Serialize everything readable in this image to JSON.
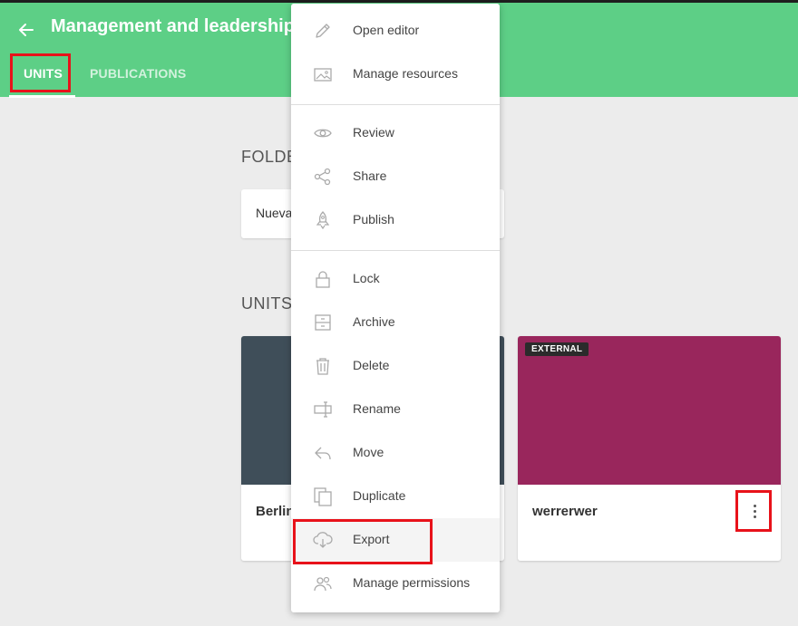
{
  "header": {
    "title": "Management and leadership",
    "tabs": [
      {
        "label": "UNITS",
        "active": true
      },
      {
        "label": "PUBLICATIONS",
        "active": false
      }
    ],
    "color": "#5dcf86"
  },
  "main": {
    "folders_heading": "FOLDE",
    "folder_name": "Nueva",
    "units_heading": "UNITS",
    "units": [
      {
        "name": "Berlin",
        "thumb_color": "#3f4e59",
        "badge": ""
      },
      {
        "name": "werrerwer",
        "thumb_color": "#99265c",
        "badge": "EXTERNAL"
      }
    ]
  },
  "context_menu": {
    "groups": [
      [
        {
          "label": "Open editor",
          "icon": "pencil-icon"
        },
        {
          "label": "Manage resources",
          "icon": "image-icon"
        }
      ],
      [
        {
          "label": "Review",
          "icon": "eye-icon"
        },
        {
          "label": "Share",
          "icon": "share-icon"
        },
        {
          "label": "Publish",
          "icon": "rocket-icon"
        }
      ],
      [
        {
          "label": "Lock",
          "icon": "lock-icon"
        },
        {
          "label": "Archive",
          "icon": "archive-icon"
        },
        {
          "label": "Delete",
          "icon": "trash-icon"
        },
        {
          "label": "Rename",
          "icon": "rename-icon"
        },
        {
          "label": "Move",
          "icon": "move-icon"
        },
        {
          "label": "Duplicate",
          "icon": "duplicate-icon"
        },
        {
          "label": "Export",
          "icon": "cloud-download-icon",
          "highlighted": true
        },
        {
          "label": "Manage permissions",
          "icon": "users-icon"
        }
      ]
    ]
  },
  "highlight_color": "#e8121a"
}
